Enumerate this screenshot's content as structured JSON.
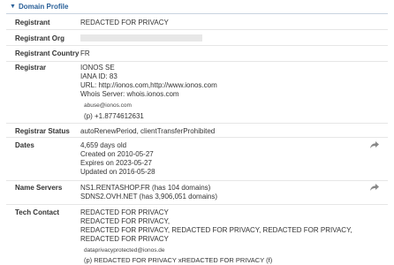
{
  "header": {
    "caret": "▼",
    "title": "Domain Profile"
  },
  "rows": {
    "registrant": {
      "label": "Registrant",
      "value": "REDACTED FOR PRIVACY"
    },
    "registrant_org": {
      "label": "Registrant Org"
    },
    "registrant_country": {
      "label": "Registrant Country",
      "value": "FR"
    },
    "registrar": {
      "label": "Registrar",
      "lines": [
        "IONOS SE",
        "IANA ID: 83",
        "URL: http://ionos.com,http://www.ionos.com",
        "Whois Server: whois.ionos.com"
      ],
      "email_image": "abuse@ionos.com",
      "phone_image": "(p)  +1.8774612631"
    },
    "registrar_status": {
      "label": "Registrar Status",
      "value": "autoRenewPeriod, clientTransferProhibited"
    },
    "dates": {
      "label": "Dates",
      "lines": [
        "4,659 days old",
        "Created on 2010-05-27",
        "Expires on 2023-05-27",
        "Updated on 2016-05-28"
      ]
    },
    "name_servers": {
      "label": "Name Servers",
      "lines": [
        "NS1.RENTASHOP.FR (has 104 domains)",
        "SDNS2.OVH.NET (has 3,906,051 domains)"
      ]
    },
    "tech_contact": {
      "label": "Tech Contact",
      "lines": [
        "REDACTED FOR PRIVACY",
        "REDACTED FOR PRIVACY,",
        "REDACTED FOR PRIVACY, REDACTED FOR PRIVACY, REDACTED FOR PRIVACY, REDACTED FOR PRIVACY"
      ],
      "email_image": "dataprivacyprotected@ionos.de",
      "phone_image": "(p)  REDACTED FOR PRIVACY xREDACTED FOR PRIVACY   (f)"
    }
  },
  "colors": {
    "accent": "#2a6099",
    "label": "#333333",
    "divider": "#e6e6e6",
    "redact": "#e7e7e7"
  },
  "icons": {
    "share": "share-arrow-icon"
  }
}
